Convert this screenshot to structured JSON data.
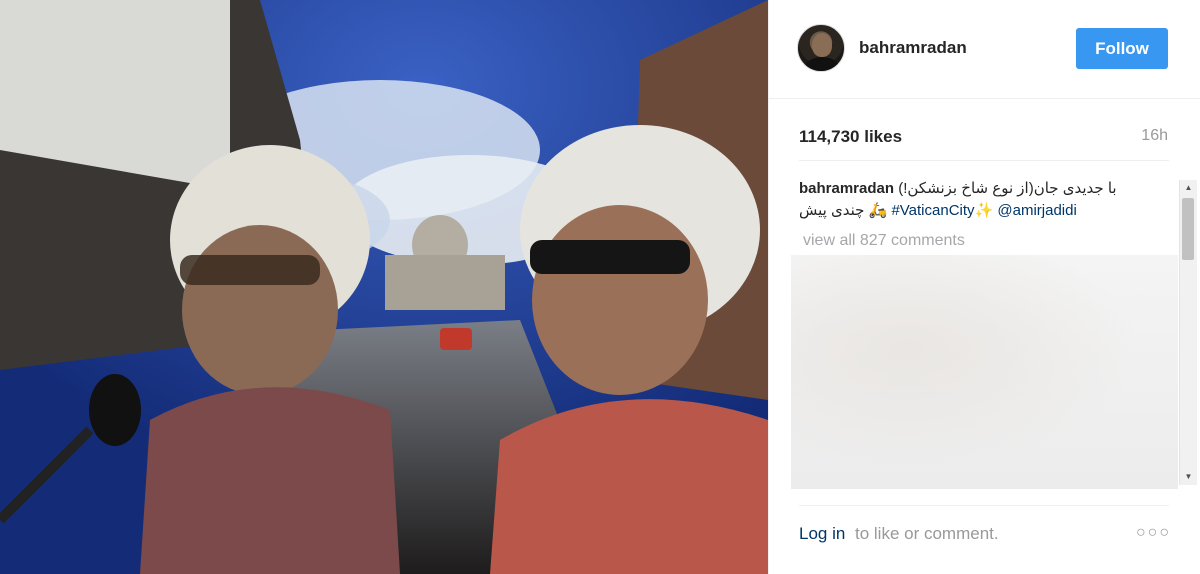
{
  "post": {
    "username": "bahramradan",
    "follow_label": "Follow",
    "likes": "114,730 likes",
    "time_ago": "16h",
    "caption_user": "bahramradan",
    "caption_text_fa": "با جدیدی جان(از نوع شاخ بزنشکن!)",
    "caption_tag": "#VaticanCity",
    "caption_mention": "@amirjadidi",
    "caption_tail_fa": "چندی پیش",
    "view_all": "view all 827 comments"
  },
  "footer": {
    "login_label": "Log in",
    "login_rest": "to like or comment.",
    "more_icon": "more-options-icon"
  },
  "colors": {
    "accent": "#3897f0",
    "link": "#003569",
    "muted": "#999999"
  }
}
